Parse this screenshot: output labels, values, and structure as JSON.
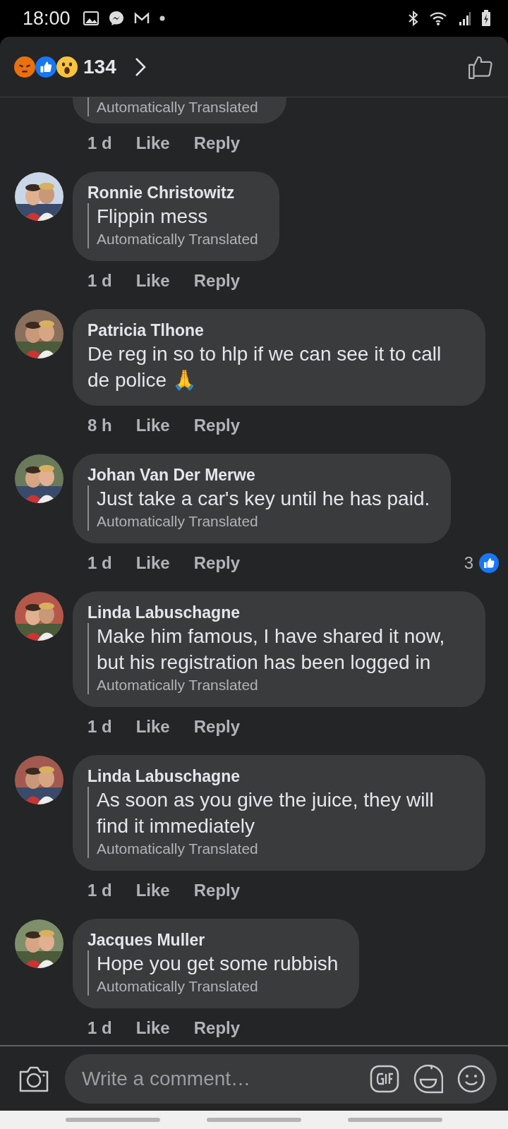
{
  "status_bar": {
    "time": "18:00"
  },
  "header": {
    "reaction_count": "134"
  },
  "partial_comment": {
    "translation_note": "Automatically Translated",
    "time": "1 d",
    "actions": [
      "Like",
      "Reply"
    ]
  },
  "comments": [
    {
      "name": "Ronnie Christowitz",
      "text": "Flippin mess",
      "translation_note": "Automatically Translated",
      "time": "1 d",
      "actions": [
        "Like",
        "Reply"
      ]
    },
    {
      "name": "Patricia Tlhone",
      "text": "De reg in  so to hlp if we can see it to call de police 🙏",
      "time": "8 h",
      "actions": [
        "Like",
        "Reply"
      ]
    },
    {
      "name": "Johan Van Der Merwe",
      "text": "Just take a car's key until he has paid.",
      "translation_note": "Automatically Translated",
      "time": "1 d",
      "actions": [
        "Like",
        "Reply"
      ],
      "likes": "3"
    },
    {
      "name": "Linda Labuschagne",
      "text": "Make him famous, I have shared it now, but his registration has been logged in",
      "translation_note": "Automatically Translated",
      "time": "1 d",
      "actions": [
        "Like",
        "Reply"
      ]
    },
    {
      "name": "Linda Labuschagne",
      "text": "As soon as you give the juice, they will find it immediately",
      "translation_note": "Automatically Translated",
      "time": "1 d",
      "actions": [
        "Like",
        "Reply"
      ]
    },
    {
      "name": "Jacques Muller",
      "text": "Hope you get some rubbish",
      "translation_note": "Automatically Translated",
      "time": "1 d",
      "actions": [
        "Like",
        "Reply"
      ]
    }
  ],
  "composer": {
    "placeholder": "Write a comment…"
  }
}
